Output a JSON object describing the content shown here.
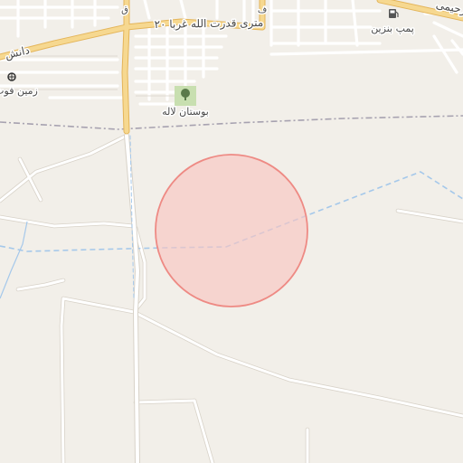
{
  "labels": {
    "street_main": "۲۰ متری قدرت الله غربا",
    "street_left": "دانش",
    "street_right": "رحیمی",
    "poi_fuel": "پمپ بنزین",
    "poi_park": "بوستان لاله",
    "poi_land": "زمین فوت",
    "vertical_left": "ق",
    "vertical_mid": "ف"
  },
  "icons": {
    "fuel": "fuel-pump-icon",
    "park": "tree-icon",
    "sports": "sports-field-icon"
  },
  "colors": {
    "background": "#f2efe9",
    "major_road": "#f6d890",
    "major_road_casing": "#e4b55a",
    "minor_road": "#ffffff",
    "minor_road_casing": "#d8d2c8",
    "boundary": "#a7a2b0",
    "waterway": "#a5c8ea",
    "circle_fill": "#f7c5c2",
    "circle_stroke": "#ee8a84",
    "park_fill": "#c8dfb0"
  }
}
